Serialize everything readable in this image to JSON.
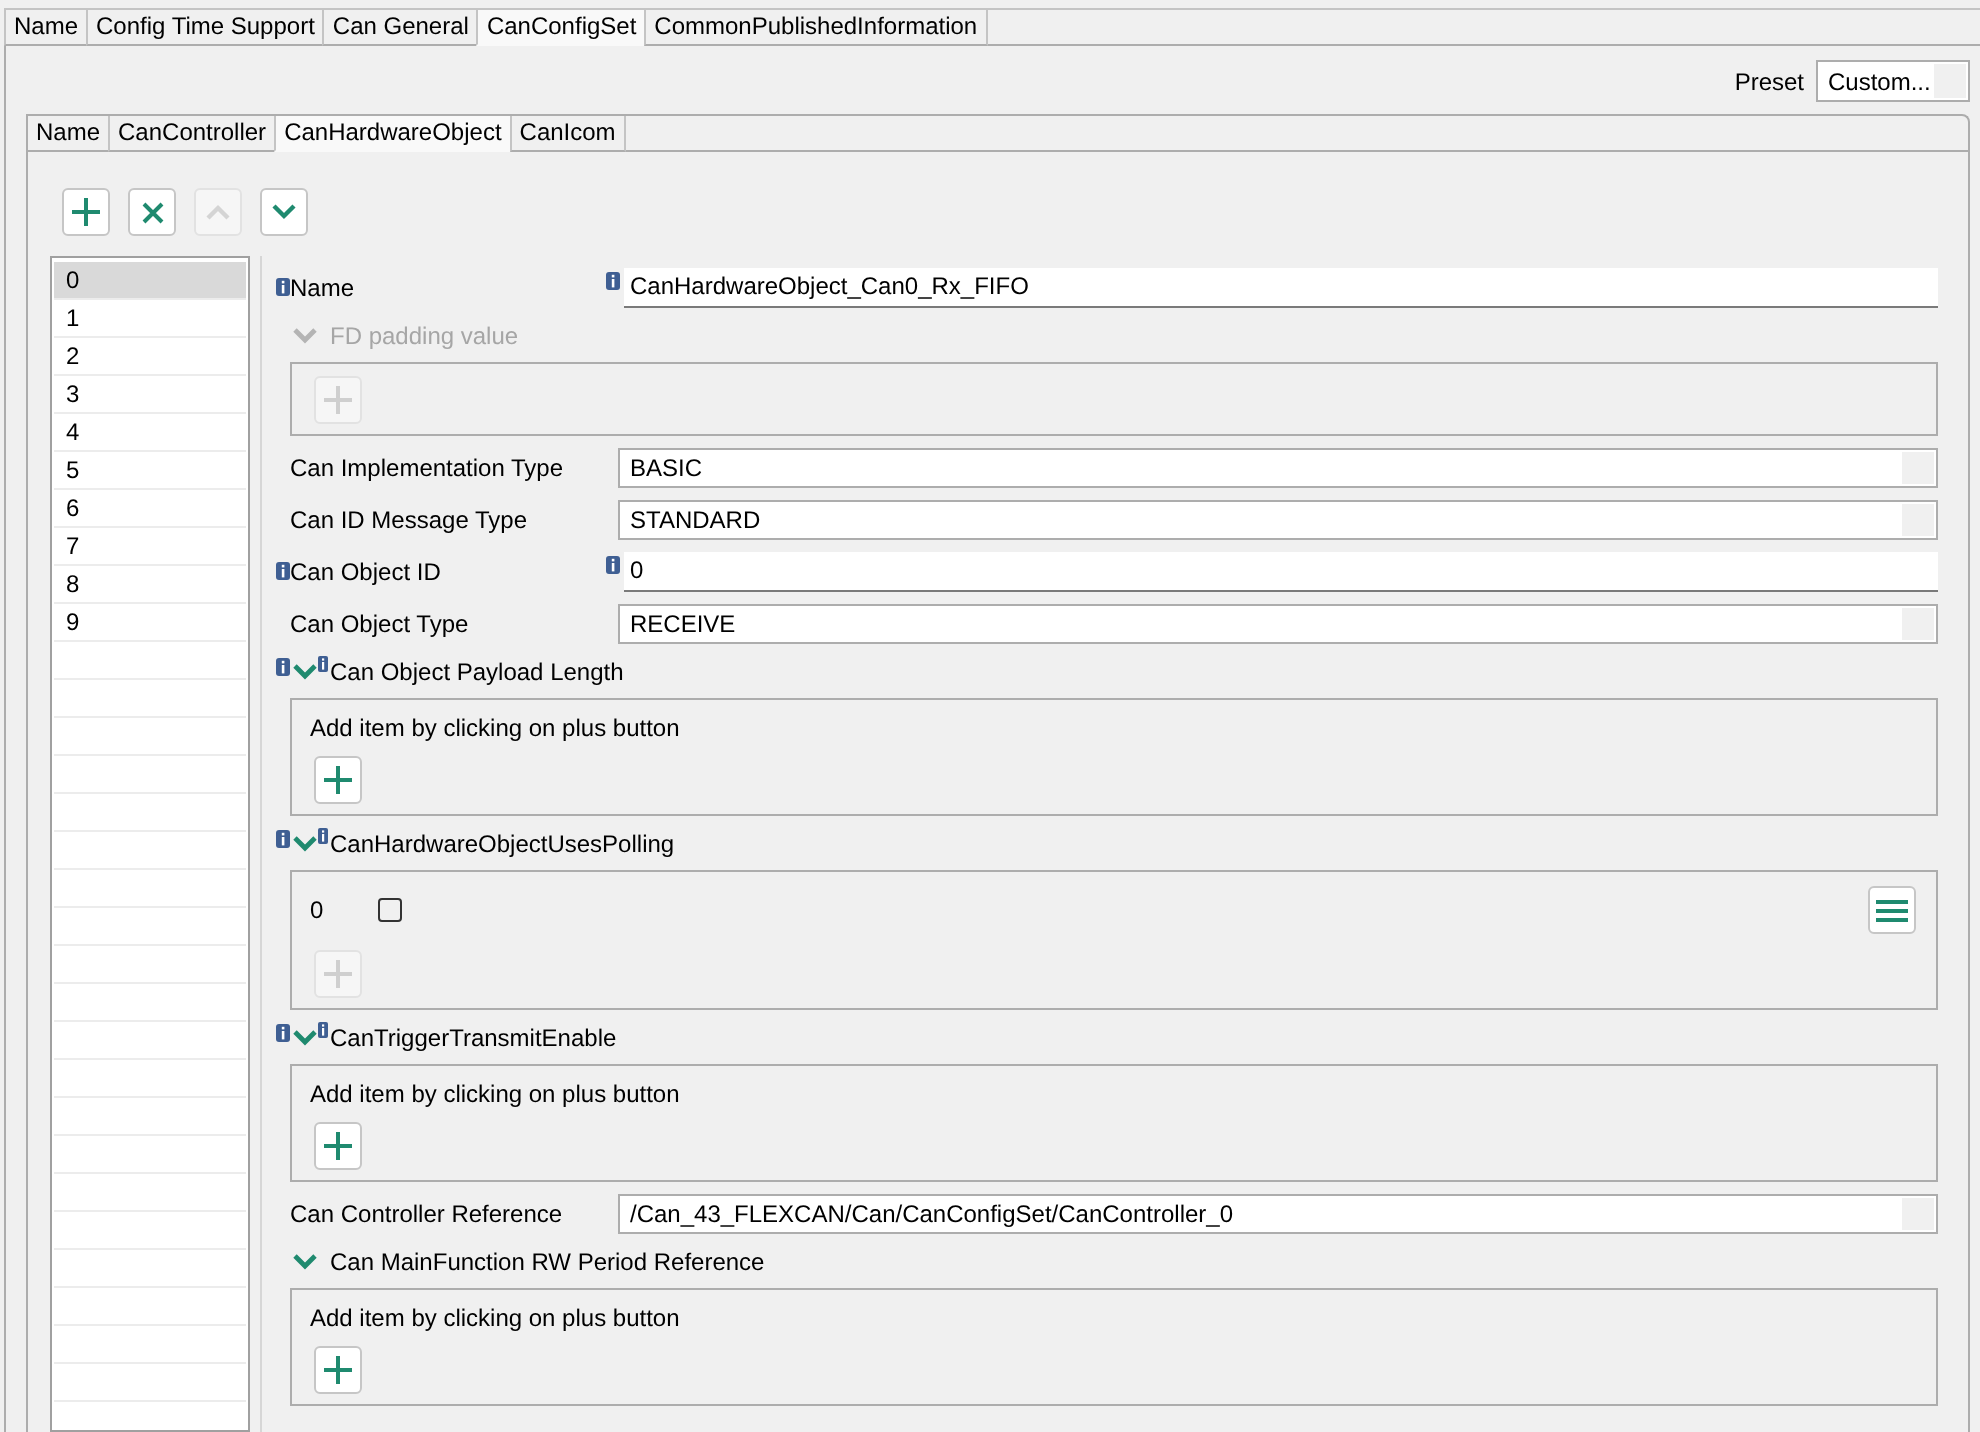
{
  "outer_tabs": [
    {
      "label": "Name",
      "selected": false
    },
    {
      "label": "Config Time Support",
      "selected": false
    },
    {
      "label": "Can General",
      "selected": false
    },
    {
      "label": "CanConfigSet",
      "selected": true
    },
    {
      "label": "CommonPublishedInformation",
      "selected": false
    }
  ],
  "preset": {
    "label": "Preset",
    "value": "Custom..."
  },
  "inner_tabs": [
    {
      "label": "Name",
      "selected": false
    },
    {
      "label": "CanController",
      "selected": false
    },
    {
      "label": "CanHardwareObject",
      "selected": true
    },
    {
      "label": "CanIcom",
      "selected": false
    }
  ],
  "toolbar": [
    {
      "kind": "add",
      "disabled": false
    },
    {
      "kind": "remove",
      "disabled": false
    },
    {
      "kind": "up",
      "disabled": true
    },
    {
      "kind": "down",
      "disabled": false
    }
  ],
  "index_list": {
    "items": [
      {
        "label": "0",
        "selected": true
      },
      {
        "label": "1",
        "selected": false
      },
      {
        "label": "2",
        "selected": false
      },
      {
        "label": "3",
        "selected": false
      },
      {
        "label": "4",
        "selected": false
      },
      {
        "label": "5",
        "selected": false
      },
      {
        "label": "6",
        "selected": false
      },
      {
        "label": "7",
        "selected": false
      },
      {
        "label": "8",
        "selected": false
      },
      {
        "label": "9",
        "selected": false
      }
    ]
  },
  "form": {
    "rows": [
      {
        "kind": "text",
        "label": "Name",
        "info": true,
        "value_info": true,
        "value": "CanHardwareObject_Can0_Rx_FIFO"
      },
      {
        "kind": "group",
        "title": "FD padding value",
        "info": false,
        "title_info": false,
        "disabled": true,
        "expanded": true,
        "add_disabled": true
      },
      {
        "kind": "combo",
        "label": "Can Implementation Type",
        "value": "BASIC"
      },
      {
        "kind": "combo",
        "label": "Can ID Message Type",
        "value": "STANDARD"
      },
      {
        "kind": "text",
        "label": "Can Object ID",
        "info": true,
        "value_info": true,
        "value": "0"
      },
      {
        "kind": "combo",
        "label": "Can Object Type",
        "value": "RECEIVE"
      },
      {
        "kind": "group",
        "title": "Can Object Payload Length",
        "info": true,
        "title_info": true,
        "disabled": false,
        "expanded": true,
        "message": "Add item by clicking on plus button",
        "add_disabled": false
      },
      {
        "kind": "group",
        "title": "CanHardwareObjectUsesPolling",
        "info": true,
        "title_info": true,
        "disabled": false,
        "expanded": true,
        "items": [
          {
            "label": "0",
            "checked": false
          }
        ],
        "add_disabled": true
      },
      {
        "kind": "group",
        "title": "CanTriggerTransmitEnable",
        "info": true,
        "title_info": true,
        "disabled": false,
        "expanded": true,
        "message": "Add item by clicking on plus button",
        "add_disabled": false
      },
      {
        "kind": "combo",
        "label": "Can Controller Reference",
        "value": "/Can_43_FLEXCAN/Can/CanConfigSet/CanController_0"
      },
      {
        "kind": "group",
        "title": "Can MainFunction RW Period Reference",
        "info": false,
        "title_info": false,
        "disabled": false,
        "expanded": true,
        "message": "Add item by clicking on plus button",
        "add_disabled": false
      }
    ]
  }
}
